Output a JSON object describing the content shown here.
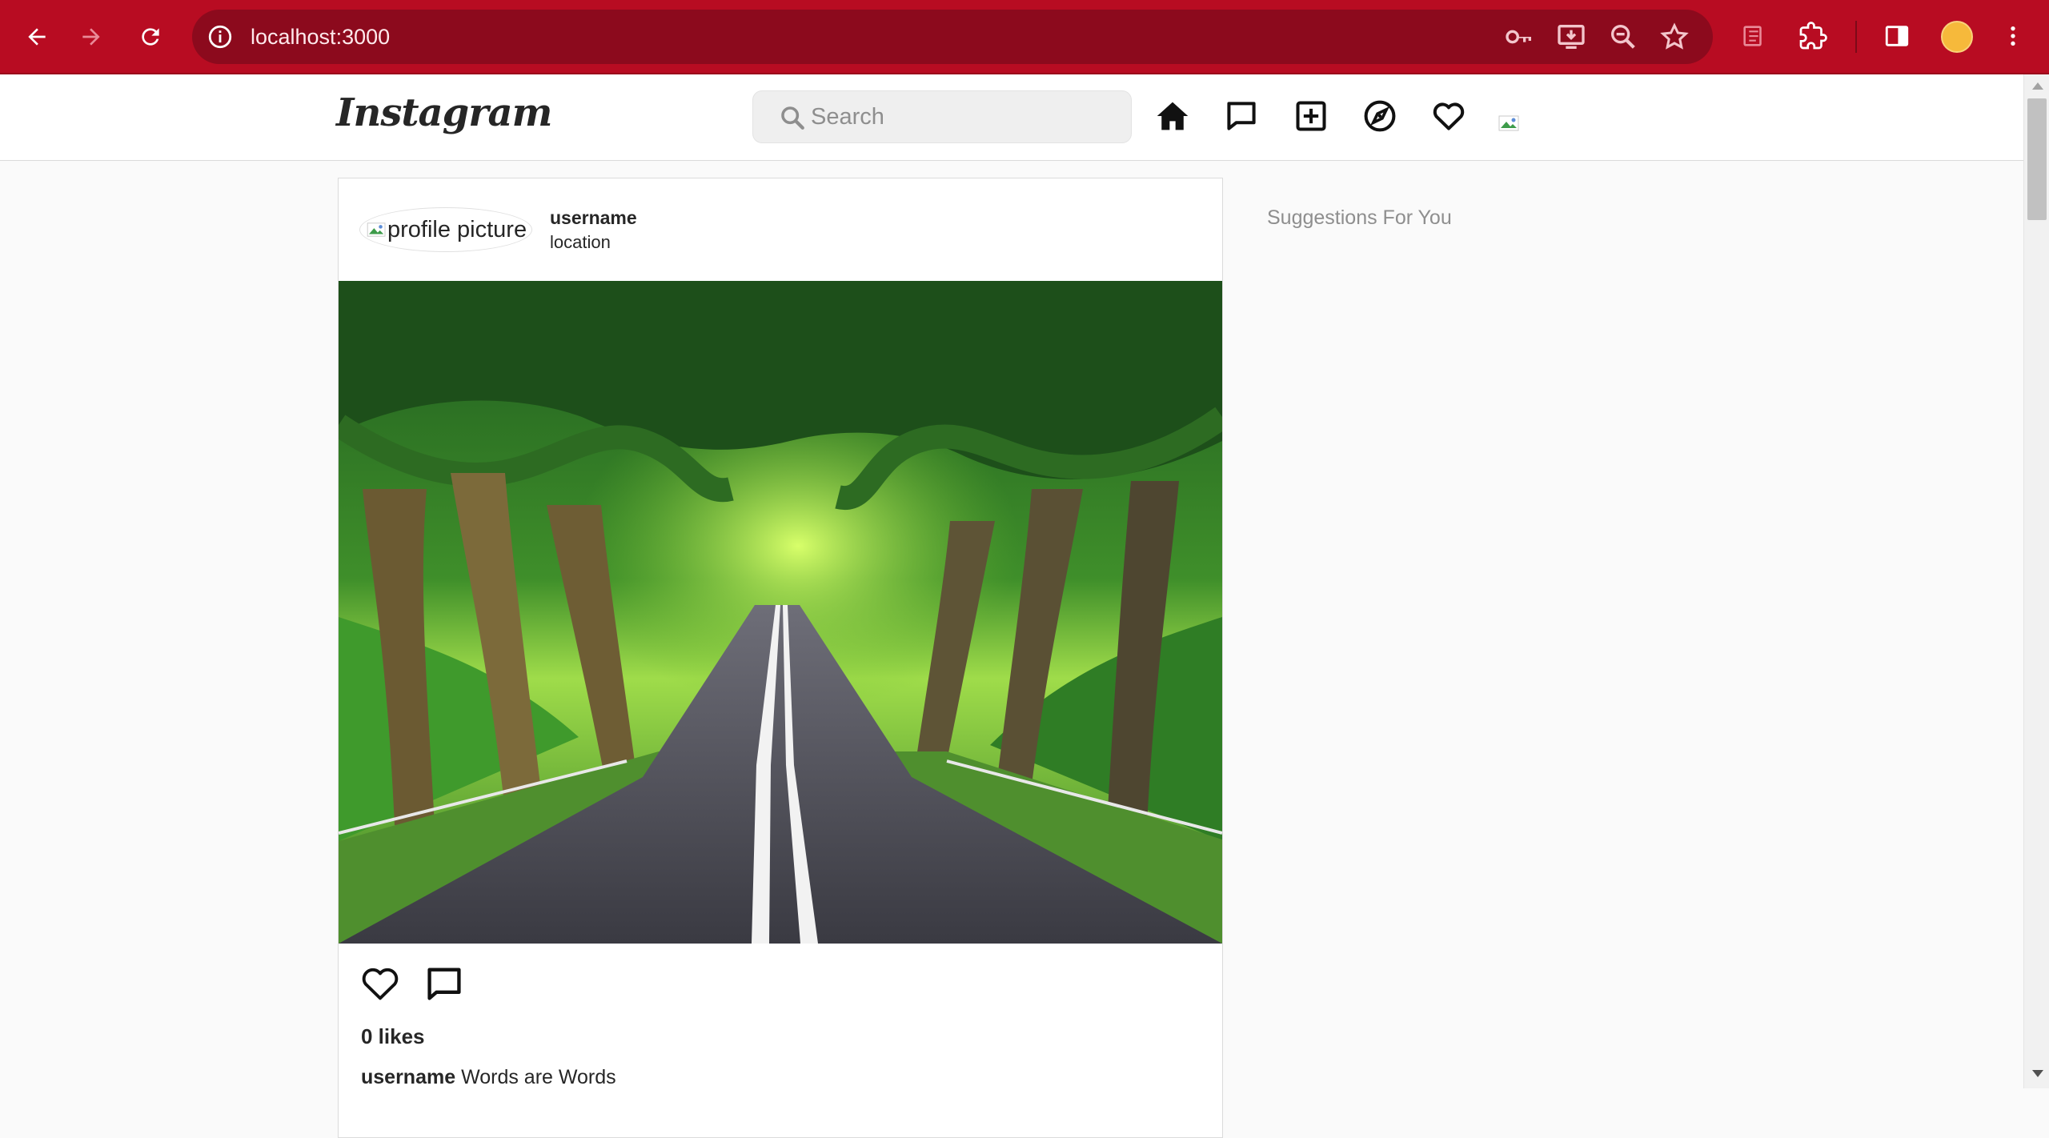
{
  "browser": {
    "url": "localhost:3000",
    "accent_color": "#b80c22",
    "icons": [
      "back-icon",
      "forward-icon",
      "reload-icon",
      "site-info-icon",
      "password-key-icon",
      "install-app-icon",
      "zoom-icon",
      "bookmark-star-icon",
      "tab-search-icon",
      "extensions-puzzle-icon",
      "side-panel-icon",
      "profile-avatar",
      "more-menu-icon"
    ]
  },
  "header": {
    "logo": "Instagram",
    "search_placeholder": "Search",
    "icons": [
      "home-icon",
      "messages-icon",
      "new-post-icon",
      "explore-icon",
      "activity-heart-icon",
      "profile-avatar-broken"
    ]
  },
  "post": {
    "profile_alt": "profile picture",
    "username": "username",
    "location": "location",
    "image_description": "tree tunnel road",
    "likes": "0 likes",
    "caption_user": "username",
    "caption_text": "Words are Words"
  },
  "sidebar": {
    "title": "Suggestions For You"
  }
}
